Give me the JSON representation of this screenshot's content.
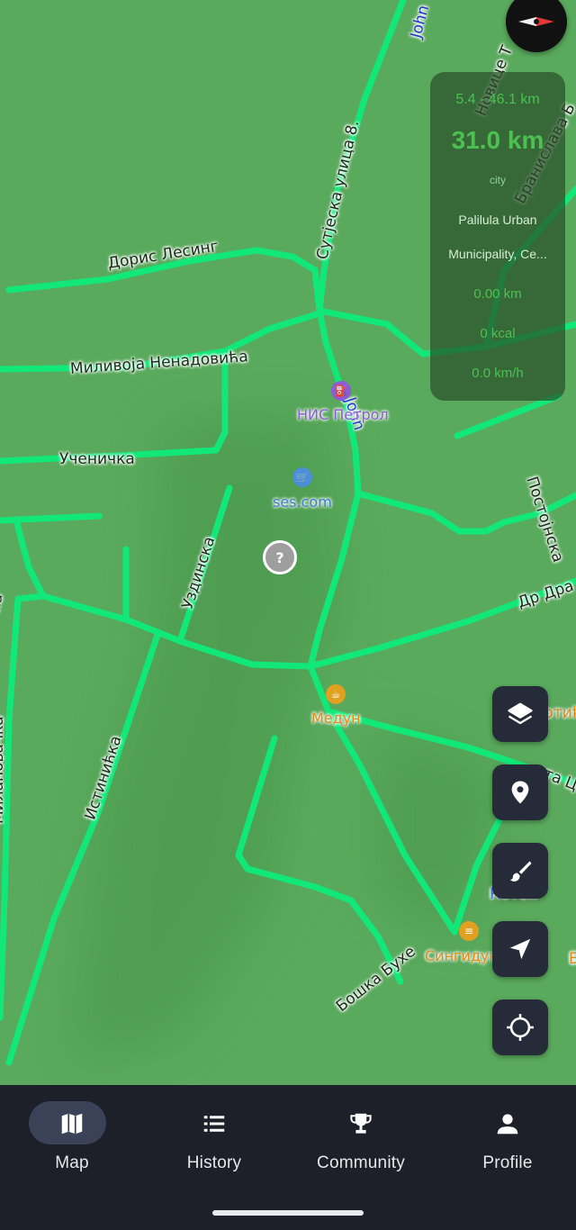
{
  "map": {
    "streets": {
      "doris_lesing": "Дорис Лесинг",
      "milivoja": "Миливоја Ненадовића",
      "ucenicka": "Ученичка",
      "sutjeska": "Сутјеска улица 8.",
      "uzdinska": "Уздинска",
      "milanovacka": "Милановачка",
      "istinicka": "Истинићка",
      "boska_buhe": "Бошка Бухе",
      "postojnska": "Постојнска",
      "dr_dra": "Др Дра",
      "novice": "Новице Т",
      "branislava": "Бранислава Б",
      "john_top": "John",
      "john_mid": "John",
      "left_cut": "ка",
      "right_cut1": "ртић",
      "right_cut2": "ста Ц",
      "right_cut3": "Б",
      "kote": "Котех"
    },
    "pois": {
      "nis": "НИС Петрол",
      "ses": "ses.com",
      "medun": "Медун",
      "singidun": "Сингидун"
    },
    "unknown_marker": "?"
  },
  "stats": {
    "range": "5.4 - 46.1 km",
    "distance": "31.0 km",
    "place_type": "city",
    "place_line1": "Palilula Urban",
    "place_line2": "Municipality, Ce...",
    "walked": "0.00 km",
    "calories": "0 kcal",
    "speed": "0.0 km/h"
  },
  "colors": {
    "map_bg": "#5aaa5d",
    "road": "#11e879",
    "stats_text": "#4cc151",
    "fab_bg": "#262b3a",
    "nav_bg": "#1d1f29",
    "nav_active_pill": "#3b4258"
  },
  "fabs": [
    "layers-icon",
    "pin-icon",
    "brush-icon",
    "navigate-arrow-icon",
    "locate-crosshair-icon"
  ],
  "nav": {
    "active": "map",
    "items": [
      {
        "id": "map",
        "label": "Map",
        "icon": "map-icon"
      },
      {
        "id": "history",
        "label": "History",
        "icon": "list-icon"
      },
      {
        "id": "community",
        "label": "Community",
        "icon": "trophy-icon"
      },
      {
        "id": "profile",
        "label": "Profile",
        "icon": "person-icon"
      }
    ]
  }
}
